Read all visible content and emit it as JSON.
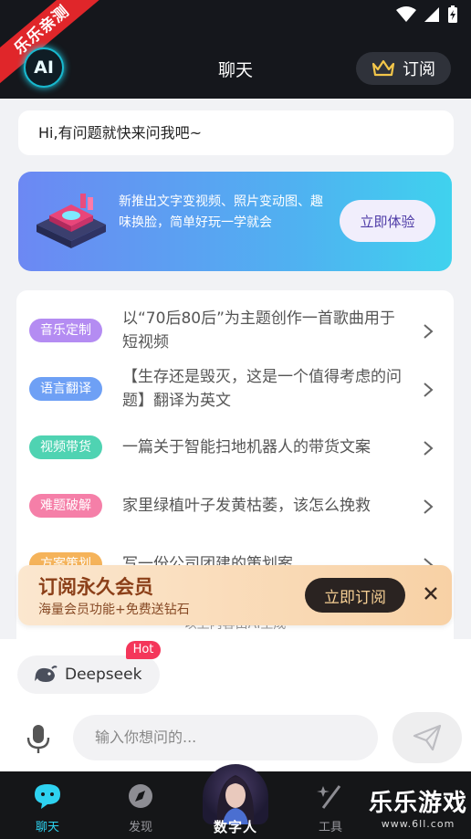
{
  "header": {
    "ribbon_text": "乐乐亲测",
    "logo_text": "AI",
    "title": "聊天",
    "subscribe_label": "订阅"
  },
  "greeting": "Hi,有问题就快来问我吧~",
  "banner": {
    "text": "新推出文字变视频、照片变动图、趣味换脸，简单好玩一学就会",
    "button_label": "立即体验"
  },
  "suggestions": [
    {
      "tag": "音乐定制",
      "tag_color": "#b48cf2",
      "text": "以“70后80后”为主题创作一首歌曲用于短视频"
    },
    {
      "tag": "语言翻译",
      "tag_color": "#6ea0f5",
      "text": "【生存还是毁灭，这是一个值得考虑的问题】翻译为英文"
    },
    {
      "tag": "视频带货",
      "tag_color": "#4fd3b2",
      "text": "一篇关于智能扫地机器人的带货文案"
    },
    {
      "tag": "难题破解",
      "tag_color": "#f57fa8",
      "text": "家里绿植叶子发黄枯萎，该怎么挽救"
    },
    {
      "tag": "方案策划",
      "tag_color": "#f5b35a",
      "text": "写一份公司团建的策划案"
    }
  ],
  "ai_notice": "以上内容由AI生成",
  "member_popup": {
    "title": "订阅永久会员",
    "subtitle": "海量会员功能+免费送钻石",
    "button_label": "立即订阅"
  },
  "model": {
    "name": "Deepseek",
    "badge": "Hot"
  },
  "input": {
    "placeholder": "输入你想问的..."
  },
  "nav": {
    "chat": "聊天",
    "discover": "发现",
    "digital_human": "数字人",
    "tools": "工具"
  },
  "watermark": {
    "main": "乐乐游戏",
    "url": "www.6ll.com"
  },
  "colors": {
    "accent": "#2ed2f0",
    "header_bg": "#15171c"
  }
}
